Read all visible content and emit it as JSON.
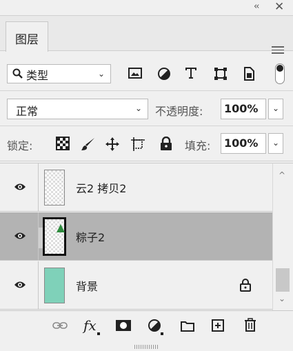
{
  "panel": {
    "title_controls": {
      "collapse": "‹‹",
      "close": "✕"
    },
    "tab_label": "图层",
    "filter": {
      "selected": "类型"
    },
    "blend": {
      "mode": "正常",
      "opacity_label": "不透明度:",
      "opacity_value": "100%"
    },
    "lock": {
      "label": "锁定:",
      "fill_label": "填充:",
      "fill_value": "100%"
    },
    "layers": [
      {
        "name": "云2 拷贝2",
        "visible": true,
        "selected": false,
        "locked": false,
        "thumb": "transparent"
      },
      {
        "name": "粽子2",
        "visible": true,
        "selected": true,
        "locked": false,
        "thumb": "leaf"
      },
      {
        "name": "背景",
        "visible": true,
        "selected": false,
        "locked": true,
        "thumb": "#7fd1b9"
      }
    ],
    "bottom_icons": [
      "link-icon",
      "fx-icon",
      "mask-icon",
      "adjustment-icon",
      "folder-icon",
      "new-layer-icon",
      "trash-icon"
    ],
    "fx_label": "fx"
  },
  "colors": {
    "selected_row": "#b3b3b3",
    "background_thumb": "#7fd1b9",
    "leaf": "#2e8b3e"
  }
}
